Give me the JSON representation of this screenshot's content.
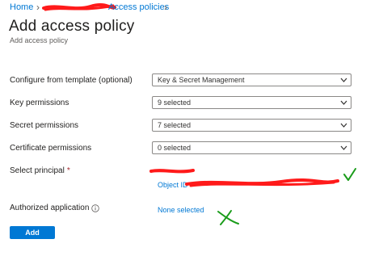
{
  "breadcrumb": {
    "home": "Home",
    "access_policies": "Access policies"
  },
  "page": {
    "title": "Add access policy",
    "subtitle": "Add access policy"
  },
  "form": {
    "template_label": "Configure from template (optional)",
    "template_value": "Key & Secret Management",
    "key_label": "Key permissions",
    "key_value": "9 selected",
    "secret_label": "Secret permissions",
    "secret_value": "7 selected",
    "cert_label": "Certificate permissions",
    "cert_value": "0 selected",
    "principal_label": "Select principal",
    "required_mark": "*",
    "principal_value": "Object ID",
    "app_label": "Authorized application",
    "app_value": "None selected"
  },
  "actions": {
    "add_label": "Add"
  },
  "icons": {
    "breadcrumb_separator": "chevron-right-icon",
    "dropdown": "chevron-down-icon",
    "info": "info-icon",
    "checkmark": "checkmark-annotation-icon",
    "cross": "cross-annotation-icon"
  },
  "colors": {
    "accent": "#0078d4",
    "annotation_red": "#ff1a1a",
    "annotation_green": "#1a9c1a",
    "required": "#a4262c"
  }
}
